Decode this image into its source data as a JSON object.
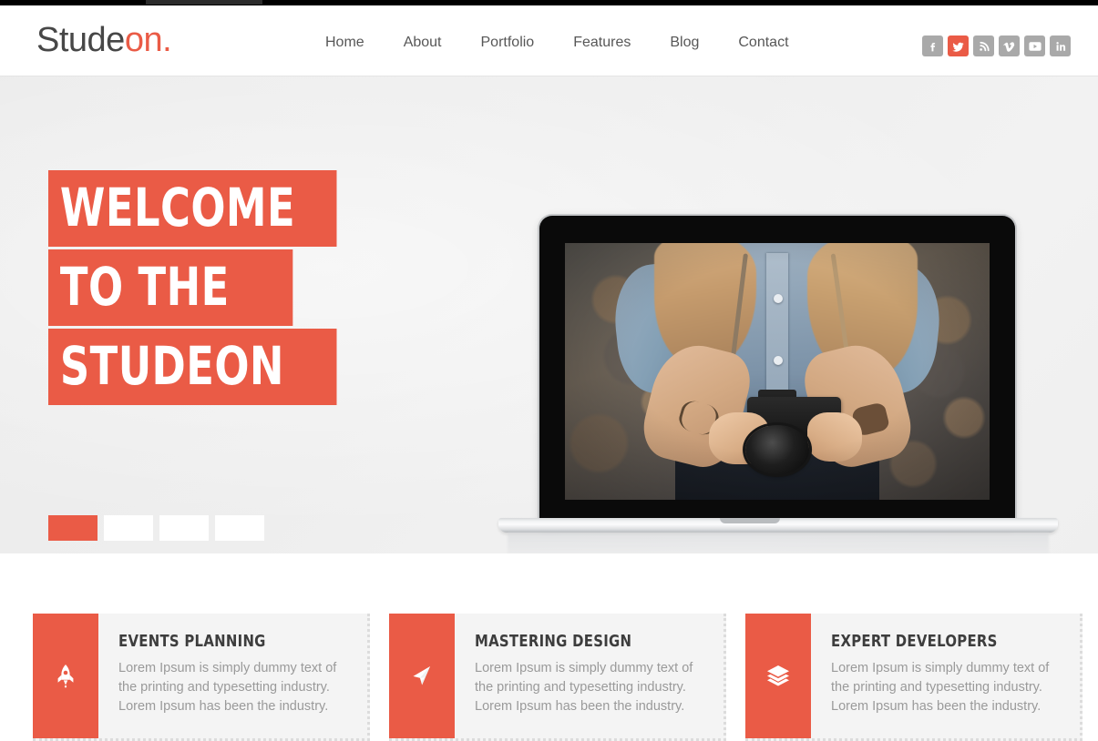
{
  "colors": {
    "accent": "#ea5b46",
    "header_text": "#575757",
    "logo_dark": "#474747",
    "hero_bg": "#efefef",
    "card_bg": "#f4f4f4",
    "card_title": "#3d3d3d",
    "card_text": "#9a9a9a",
    "social_idle": "#a9a9a9"
  },
  "header": {
    "logo_primary": "Stude",
    "logo_accent": "on.",
    "nav": [
      {
        "label": "Home",
        "name": "nav-home"
      },
      {
        "label": "About",
        "name": "nav-about"
      },
      {
        "label": "Portfolio",
        "name": "nav-portfolio"
      },
      {
        "label": "Features",
        "name": "nav-features"
      },
      {
        "label": "Blog",
        "name": "nav-blog"
      },
      {
        "label": "Contact",
        "name": "nav-contact"
      }
    ],
    "social": [
      {
        "icon": "facebook-icon",
        "label": "Facebook",
        "active": false
      },
      {
        "icon": "twitter-icon",
        "label": "Twitter",
        "active": true
      },
      {
        "icon": "rss-icon",
        "label": "RSS",
        "active": false
      },
      {
        "icon": "vimeo-icon",
        "label": "Vimeo",
        "active": false
      },
      {
        "icon": "youtube-icon",
        "label": "YouTube",
        "active": false
      },
      {
        "icon": "linkedin-icon",
        "label": "LinkedIn",
        "active": false
      }
    ]
  },
  "hero": {
    "caption_lines": [
      "WELCOME",
      "TO THE",
      "STUDEON"
    ],
    "slides": [
      {
        "label": "Slide 1",
        "active": true
      },
      {
        "label": "Slide 2",
        "active": false
      },
      {
        "label": "Slide 3",
        "active": false
      },
      {
        "label": "Slide 4",
        "active": false
      }
    ],
    "device": "macbook-laptop-mockup",
    "screen_image_alt": "Woman in denim shirt holding a vintage film camera"
  },
  "features": [
    {
      "icon": "rocket-icon",
      "title": "EVENTS PLANNING",
      "text": "Lorem Ipsum is simply dummy text of the printing and typesetting industry. Lorem Ipsum has been the industry."
    },
    {
      "icon": "cursor-icon",
      "title": "MASTERING DESIGN",
      "text": "Lorem Ipsum is simply dummy text of the printing and typesetting industry. Lorem Ipsum has been the industry."
    },
    {
      "icon": "layers-icon",
      "title": "EXPERT DEVELOPERS",
      "text": "Lorem Ipsum is simply dummy text of the printing and typesetting industry. Lorem Ipsum has been the industry."
    }
  ]
}
